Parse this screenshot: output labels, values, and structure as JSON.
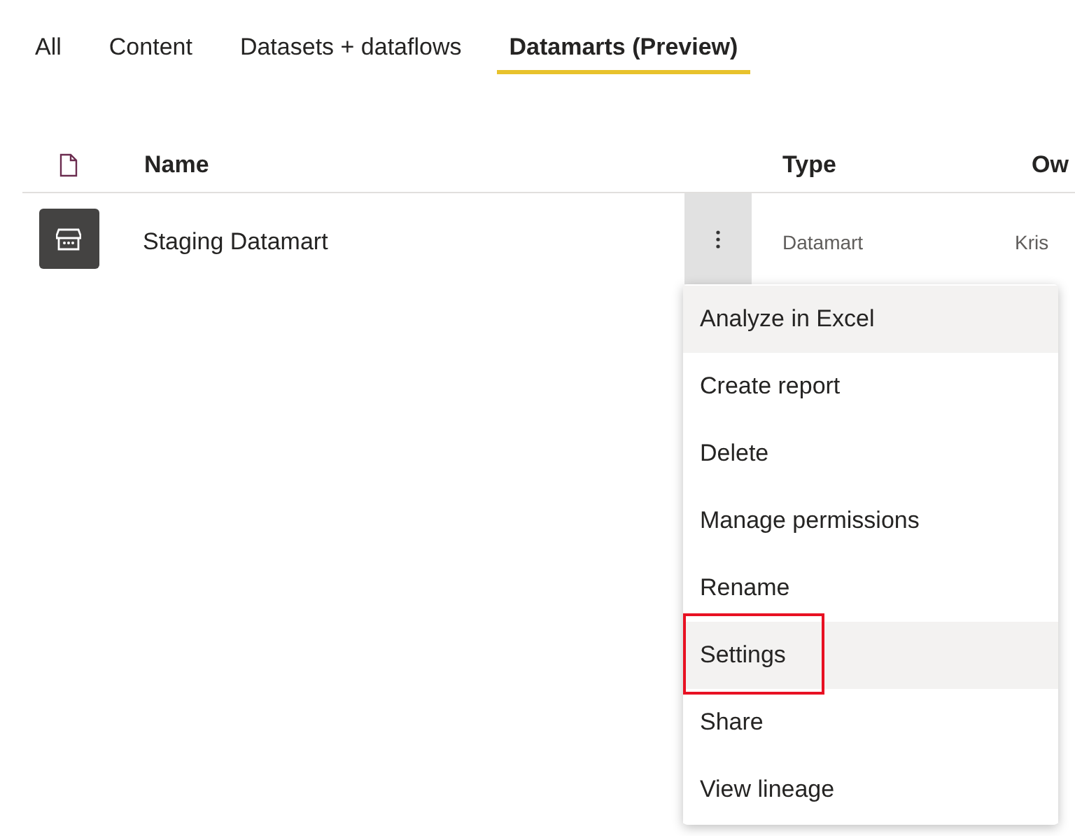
{
  "tabs": [
    {
      "label": "All",
      "selected": false
    },
    {
      "label": "Content",
      "selected": false
    },
    {
      "label": "Datasets + dataflows",
      "selected": false
    },
    {
      "label": "Datamarts (Preview)",
      "selected": true
    }
  ],
  "table": {
    "columns": [
      "Name",
      "Type",
      "Ow"
    ],
    "rows": [
      {
        "name": "Staging Datamart",
        "type": "Datamart",
        "owner": "Kris",
        "menu_open": true
      }
    ]
  },
  "context_menu": {
    "items": [
      {
        "label": "Analyze in Excel",
        "highlighted": true,
        "annotated": false
      },
      {
        "label": "Create report",
        "highlighted": false,
        "annotated": false
      },
      {
        "label": "Delete",
        "highlighted": false,
        "annotated": false
      },
      {
        "label": "Manage permissions",
        "highlighted": false,
        "annotated": false
      },
      {
        "label": "Rename",
        "highlighted": false,
        "annotated": false
      },
      {
        "label": "Settings",
        "highlighted": true,
        "annotated": true
      },
      {
        "label": "Share",
        "highlighted": false,
        "annotated": false
      },
      {
        "label": "View lineage",
        "highlighted": false,
        "annotated": false
      }
    ]
  }
}
